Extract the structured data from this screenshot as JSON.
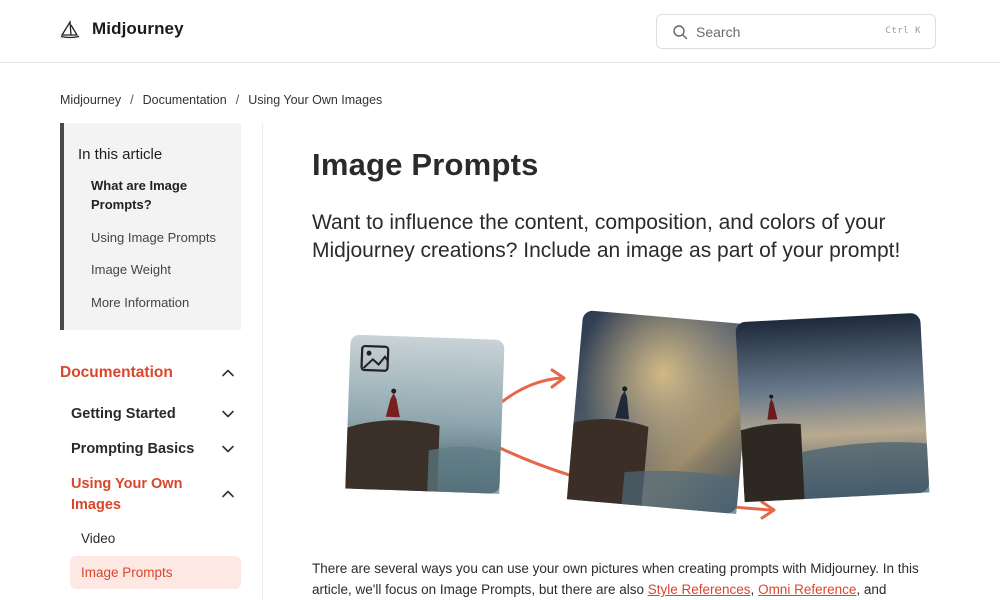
{
  "header": {
    "brand": "Midjourney",
    "search": {
      "placeholder": "Search",
      "shortcut": "Ctrl K"
    }
  },
  "breadcrumb": [
    "Midjourney",
    "Documentation",
    "Using Your Own Images"
  ],
  "toc": {
    "title": "In this article",
    "items": [
      {
        "label": "What are Image Prompts?",
        "active": true
      },
      {
        "label": "Using Image Prompts",
        "active": false
      },
      {
        "label": "Image Weight",
        "active": false
      },
      {
        "label": "More Information",
        "active": false
      }
    ]
  },
  "nav": {
    "section": "Documentation",
    "items": [
      {
        "label": "Getting Started"
      },
      {
        "label": "Prompting Basics"
      },
      {
        "label": "Using Your Own Images"
      }
    ],
    "subitems": [
      {
        "label": "Video"
      },
      {
        "label": "Image Prompts"
      }
    ]
  },
  "article": {
    "title": "Image Prompts",
    "lead": "Want to influence the content, composition, and colors of your Midjourney creations? Include an image as part of your prompt!",
    "body_before": "There are several ways you can use your own pictures when creating prompts with Midjourney. In this article, we'll focus on Image Prompts, but there are also ",
    "link1": "Style References",
    "sep1": ", ",
    "link2": "Omni Reference",
    "body_after": ", and"
  },
  "colors": {
    "accent": "#d9462b",
    "accent_bg": "#fde8e3",
    "toc_bg": "#f3f3f4"
  }
}
